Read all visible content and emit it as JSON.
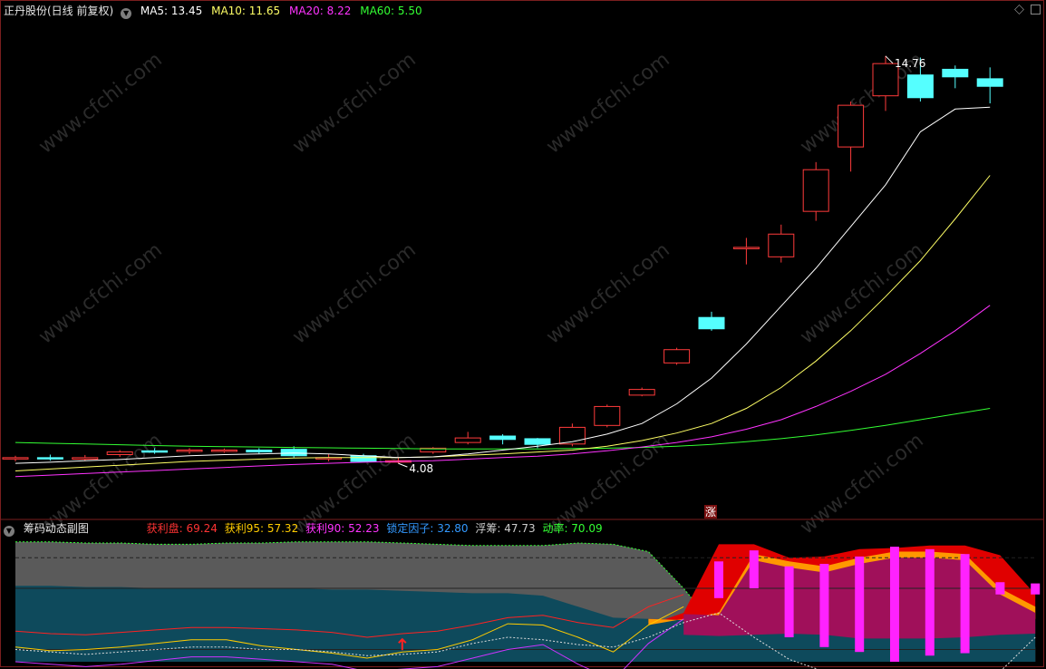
{
  "header": {
    "stock_title": "正丹股份(日线 前复权)",
    "ma": [
      {
        "label": "MA5: 13.45",
        "color": "#ffffff"
      },
      {
        "label": "MA10: 11.65",
        "color": "#ffff66"
      },
      {
        "label": "MA20: 8.22",
        "color": "#ff33ff"
      },
      {
        "label": "MA60: 5.50",
        "color": "#33ff33"
      }
    ]
  },
  "sub_header": {
    "title": "筹码动态副图",
    "items": [
      {
        "label": "获利盘: 69.24",
        "color": "#ff3333"
      },
      {
        "label": "获利95: 57.32",
        "color": "#ffcc00"
      },
      {
        "label": "获利90: 52.23",
        "color": "#ff33ff"
      },
      {
        "label": "锁定因子: 32.80",
        "color": "#3399ff"
      },
      {
        "label": "浮筹: 47.73",
        "color": "#cccccc"
      },
      {
        "label": "动率: 70.09",
        "color": "#33ff33"
      }
    ]
  },
  "watermark": "www.cfchi.com",
  "zhang_badge": "涨",
  "chart_data": [
    {
      "type": "candlestick",
      "price_range": [
        3.0,
        15.8
      ],
      "high_label": "14.76",
      "low_label": "4.08",
      "candles": [
        {
          "o": 4.18,
          "c": 4.2,
          "h": 4.25,
          "l": 4.1
        },
        {
          "o": 4.2,
          "c": 4.17,
          "h": 4.28,
          "l": 4.12
        },
        {
          "o": 4.16,
          "c": 4.2,
          "h": 4.27,
          "l": 4.12
        },
        {
          "o": 4.28,
          "c": 4.35,
          "h": 4.4,
          "l": 4.22
        },
        {
          "o": 4.38,
          "c": 4.36,
          "h": 4.45,
          "l": 4.3
        },
        {
          "o": 4.37,
          "c": 4.4,
          "h": 4.45,
          "l": 4.3
        },
        {
          "o": 4.38,
          "c": 4.4,
          "h": 4.44,
          "l": 4.33
        },
        {
          "o": 4.4,
          "c": 4.35,
          "h": 4.45,
          "l": 4.3
        },
        {
          "o": 4.42,
          "c": 4.25,
          "h": 4.5,
          "l": 4.2
        },
        {
          "o": 4.2,
          "c": 4.2,
          "h": 4.3,
          "l": 4.1
        },
        {
          "o": 4.25,
          "c": 4.1,
          "h": 4.3,
          "l": 4.08
        },
        {
          "o": 4.08,
          "c": 4.12,
          "h": 4.2,
          "l": 4.05
        },
        {
          "o": 4.35,
          "c": 4.45,
          "h": 4.48,
          "l": 4.3
        },
        {
          "o": 4.6,
          "c": 4.72,
          "h": 4.88,
          "l": 4.55
        },
        {
          "o": 4.77,
          "c": 4.68,
          "h": 4.82,
          "l": 4.55
        },
        {
          "o": 4.7,
          "c": 4.55,
          "h": 4.72,
          "l": 4.45
        },
        {
          "o": 4.56,
          "c": 5.0,
          "h": 5.1,
          "l": 4.5
        },
        {
          "o": 5.05,
          "c": 5.55,
          "h": 5.6,
          "l": 5.0
        },
        {
          "o": 5.85,
          "c": 6.0,
          "h": 6.05,
          "l": 5.82
        },
        {
          "o": 6.7,
          "c": 7.05,
          "h": 7.1,
          "l": 6.65
        },
        {
          "o": 7.9,
          "c": 7.6,
          "h": 8.05,
          "l": 7.55
        },
        {
          "o": 9.75,
          "c": 9.75,
          "h": 10.0,
          "l": 9.3
        },
        {
          "o": 9.5,
          "c": 10.1,
          "h": 10.35,
          "l": 9.35
        },
        {
          "o": 10.7,
          "c": 11.8,
          "h": 12.0,
          "l": 10.45
        },
        {
          "o": 12.4,
          "c": 13.5,
          "h": 13.6,
          "l": 11.75
        },
        {
          "o": 13.75,
          "c": 14.6,
          "h": 14.8,
          "l": 13.35
        },
        {
          "o": 14.3,
          "c": 13.7,
          "h": 14.76,
          "l": 13.6
        },
        {
          "o": 14.45,
          "c": 14.25,
          "h": 14.55,
          "l": 13.95
        },
        {
          "o": 14.2,
          "c": 14.0,
          "h": 14.5,
          "l": 13.55
        }
      ],
      "ma5": [
        4.05,
        4.08,
        4.12,
        4.15,
        4.2,
        4.25,
        4.28,
        4.3,
        4.32,
        4.3,
        4.25,
        4.2,
        4.22,
        4.3,
        4.4,
        4.5,
        4.62,
        4.82,
        5.1,
        5.62,
        6.3,
        7.2,
        8.2,
        9.2,
        10.3,
        11.4,
        12.8,
        13.4,
        13.45
      ],
      "ma10": [
        3.85,
        3.9,
        3.95,
        4.0,
        4.05,
        4.1,
        4.13,
        4.16,
        4.19,
        4.2,
        4.2,
        4.2,
        4.22,
        4.26,
        4.3,
        4.35,
        4.4,
        4.5,
        4.65,
        4.85,
        5.1,
        5.5,
        6.05,
        6.75,
        7.55,
        8.45,
        9.4,
        10.5,
        11.65
      ],
      "ma20": [
        3.7,
        3.74,
        3.78,
        3.82,
        3.86,
        3.9,
        3.94,
        3.98,
        4.02,
        4.05,
        4.08,
        4.1,
        4.12,
        4.16,
        4.2,
        4.24,
        4.3,
        4.38,
        4.48,
        4.6,
        4.75,
        4.95,
        5.2,
        5.55,
        5.95,
        6.4,
        6.95,
        7.55,
        8.22
      ],
      "ma60": [
        4.6,
        4.58,
        4.56,
        4.54,
        4.52,
        4.5,
        4.49,
        4.48,
        4.47,
        4.46,
        4.45,
        4.44,
        4.43,
        4.43,
        4.43,
        4.43,
        4.44,
        4.45,
        4.47,
        4.5,
        4.55,
        4.62,
        4.7,
        4.8,
        4.92,
        5.05,
        5.2,
        5.35,
        5.5
      ]
    },
    {
      "type": "area",
      "title": "筹码动态副图",
      "y_range": [
        0,
        100
      ],
      "reference_lines": [
        85,
        60,
        10
      ],
      "gray_area": [
        98,
        98,
        97,
        97,
        96,
        96,
        97,
        97,
        98,
        98,
        98,
        97,
        96,
        95,
        95,
        95,
        97,
        96,
        90,
        60,
        25,
        15,
        18,
        16,
        14,
        14,
        12,
        15,
        20,
        12
      ],
      "teal_area": [
        62,
        62,
        61,
        61,
        60,
        60,
        60,
        60,
        60,
        59,
        59,
        58,
        57,
        56,
        56,
        54,
        45,
        36,
        35,
        34,
        33,
        34,
        35,
        34,
        31,
        31,
        31,
        32,
        34,
        35
      ],
      "red_area": [
        0,
        0,
        0,
        0,
        0,
        0,
        0,
        0,
        0,
        0,
        0,
        0,
        0,
        0,
        0,
        0,
        0,
        0,
        30,
        40,
        96,
        96,
        85,
        86,
        92,
        93,
        95,
        95,
        87,
        55
      ],
      "orange_area": [
        0,
        0,
        0,
        0,
        0,
        0,
        0,
        0,
        0,
        0,
        0,
        0,
        0,
        0,
        0,
        0,
        0,
        0,
        30,
        35,
        40,
        88,
        82,
        78,
        85,
        90,
        90,
        88,
        60,
        45
      ],
      "magenta_bars": [
        null,
        null,
        null,
        null,
        null,
        null,
        null,
        null,
        null,
        null,
        null,
        null,
        null,
        null,
        null,
        null,
        null,
        null,
        null,
        null,
        [
          52,
          82
        ],
        [
          60,
          91
        ],
        [
          20,
          78
        ],
        [
          12,
          80
        ],
        [
          8,
          86
        ],
        [
          0,
          94
        ],
        [
          5,
          92
        ],
        [
          7,
          88
        ],
        [
          55,
          65
        ],
        [
          55,
          64
        ]
      ],
      "red_line": [
        25,
        23,
        22,
        24,
        26,
        28,
        28,
        27,
        26,
        24,
        20,
        23,
        25,
        30,
        36,
        38,
        32,
        28,
        45,
        55,
        null,
        null,
        null,
        null,
        null,
        null,
        null,
        null,
        null,
        null
      ],
      "yellow_line": [
        12,
        9,
        10,
        12,
        15,
        18,
        18,
        13,
        10,
        7,
        3,
        8,
        10,
        18,
        31,
        30,
        20,
        8,
        30,
        45,
        null,
        null,
        null,
        null,
        null,
        null,
        null,
        null,
        null,
        null
      ],
      "magenta_line": [
        0,
        -2,
        -4,
        -2,
        1,
        4,
        4,
        2,
        0,
        -2,
        -8,
        -6,
        -4,
        3,
        10,
        14,
        -2,
        -15,
        15,
        35,
        null,
        null,
        null,
        null,
        null,
        null,
        null,
        null,
        null,
        null
      ],
      "white_dotted": [
        10,
        8,
        6,
        8,
        10,
        12,
        12,
        10,
        10,
        8,
        5,
        6,
        8,
        15,
        20,
        18,
        14,
        12,
        20,
        32,
        40,
        20,
        2,
        -8,
        -20,
        -15,
        -10,
        -15,
        -8,
        20
      ],
      "marker_index": 11
    }
  ]
}
